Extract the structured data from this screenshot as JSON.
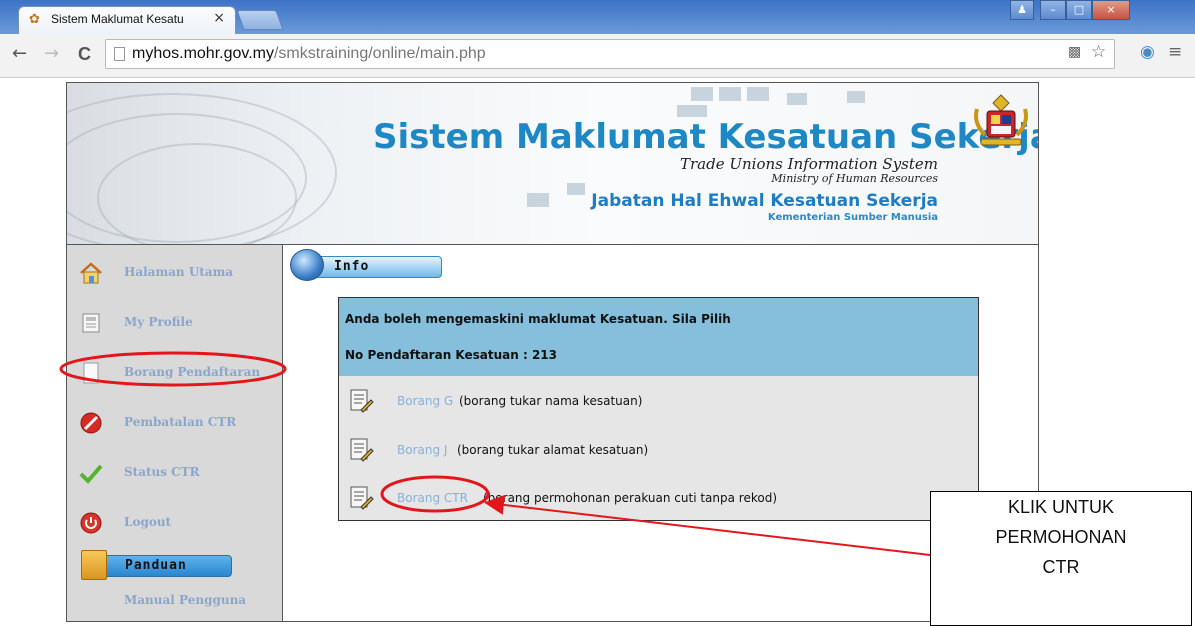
{
  "browser": {
    "tab_title": "Sistem Maklumat Kesatu",
    "tab_close": "×",
    "url_host": "myhos.mohr.gov.my",
    "url_path": "/smkstraining/online/main.php",
    "back_icon": "←",
    "forward_icon": "→",
    "reload_icon": "C",
    "menu_icon": "≡",
    "star_icon": "☆"
  },
  "banner": {
    "title": "Sistem Maklumat Kesatuan Sekerja",
    "subtitle_en": "Trade Unions Information System",
    "ministry_en": "Ministry of Human Resources",
    "department": "Jabatan Hal Ehwal Kesatuan Sekerja",
    "ministry_ms": "Kementerian Sumber Manusia"
  },
  "sidebar": {
    "items": [
      {
        "label": "Halaman Utama",
        "icon": "home-icon"
      },
      {
        "label": "My Profile",
        "icon": "profile-icon"
      },
      {
        "label": "Borang Pendaftaran",
        "icon": "document-icon"
      },
      {
        "label": "Pembatalan CTR",
        "icon": "cancel-icon"
      },
      {
        "label": "Status CTR",
        "icon": "checkmark-icon"
      },
      {
        "label": "Logout",
        "icon": "power-icon"
      }
    ],
    "guide_heading": "Panduan",
    "guide_link": "Manual Pengguna"
  },
  "main": {
    "section_title": "Info",
    "message": "Anda boleh mengemaskini maklumat Kesatuan. Sila Pilih",
    "registration": "No Pendaftaran Kesatuan : 213",
    "forms": [
      {
        "link": "Borang G",
        "desc": "(borang tukar nama kesatuan)"
      },
      {
        "link": "Borang J",
        "desc": "(borang tukar alamat kesatuan)"
      },
      {
        "link": "Borang CTR",
        "desc": "(borang permohonan perakuan cuti tanpa rekod)"
      }
    ]
  },
  "annotation": {
    "callout_lines": [
      "KLIK UNTUK",
      "PERMOHONAN",
      "CTR"
    ],
    "highlight_color": "#e3161c"
  }
}
